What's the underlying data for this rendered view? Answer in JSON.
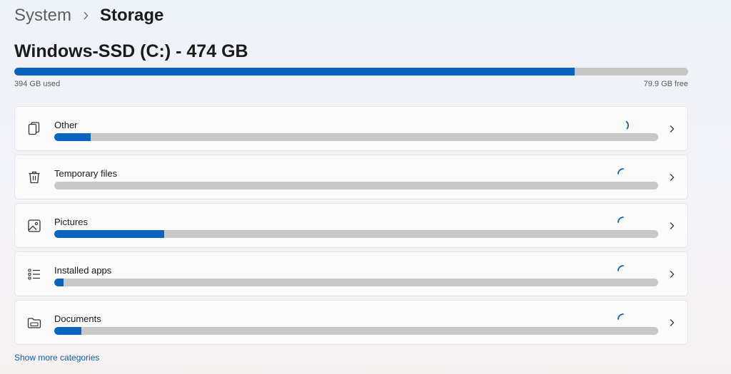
{
  "breadcrumb": {
    "parent": "System",
    "current": "Storage"
  },
  "drive": {
    "title": "Windows-SSD (C:) - 474 GB",
    "used_label": "394 GB used",
    "free_label": "79.9 GB free",
    "used_fraction": 0.832
  },
  "categories": [
    {
      "label": "Other",
      "icon": "document-icon",
      "fraction": 0.06
    },
    {
      "label": "Temporary files",
      "icon": "trash-icon",
      "fraction": 0
    },
    {
      "label": "Pictures",
      "icon": "picture-icon",
      "fraction": 0.182
    },
    {
      "label": "Installed apps",
      "icon": "apps-list-icon",
      "fraction": 0.015
    },
    {
      "label": "Documents",
      "icon": "folder-icon",
      "fraction": 0.045
    }
  ],
  "show_more": "Show more categories",
  "colors": {
    "accent": "#0a63bd",
    "track": "#c8c8c8",
    "link": "#0a5fb4"
  }
}
